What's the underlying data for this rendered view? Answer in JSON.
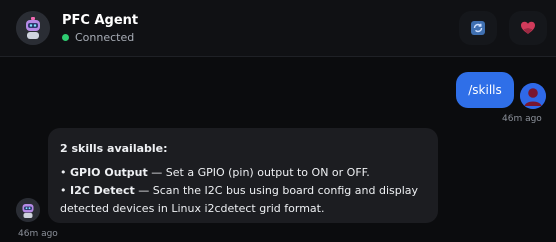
{
  "header": {
    "agent_name": "PFC Agent",
    "status_text": "Connected",
    "status_color": "#2ecc71",
    "refresh_icon": "refresh-icon",
    "heart_icon": "heart-icon",
    "heart_color": "#d13b5b",
    "refresh_color": "#3f6fb0"
  },
  "messages": {
    "user": {
      "text": "/skills",
      "timestamp": "46m ago",
      "bubble_color": "#2f6fe8"
    },
    "agent": {
      "intro": "2 skills available:",
      "items": [
        {
          "bullet": "•",
          "title": "GPIO Output",
          "description": "— Set a GPIO (pin) output to ON or OFF."
        },
        {
          "bullet": "•",
          "title": "I2C Detect",
          "description": "— Scan the I2C bus using board config and display detected devices in Linux i2cdetect grid format."
        }
      ],
      "timestamp": "46m ago"
    }
  }
}
